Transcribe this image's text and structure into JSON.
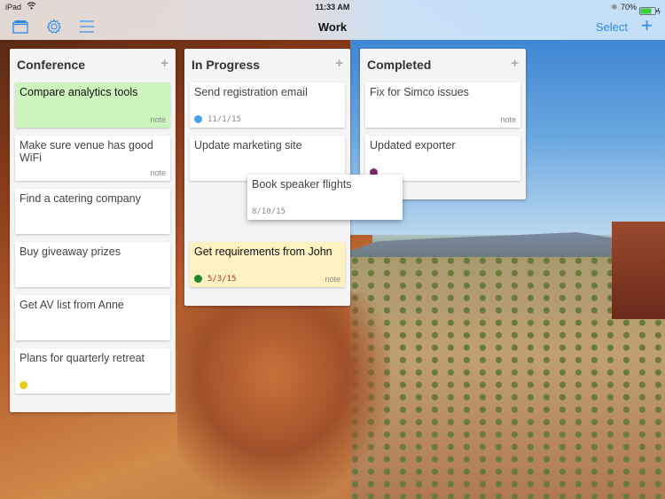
{
  "status_bar": {
    "device": "iPad",
    "time": "11:33 AM",
    "battery": "70%"
  },
  "nav": {
    "title": "Work",
    "select_label": "Select",
    "add_label": "+",
    "icons": [
      "boards-icon",
      "gear-icon",
      "menu-icon"
    ]
  },
  "colors": {
    "accent": "#2d8ae6",
    "green_card": "#ccf5be",
    "yellow_card": "#fdf2c0"
  },
  "columns": [
    {
      "title": "Conference",
      "add_label": "+",
      "cards": [
        {
          "title": "Compare analytics tools",
          "note": "note",
          "color": "green"
        },
        {
          "title": "Make sure venue has good WiFi",
          "note": "note"
        },
        {
          "title": "Find a catering company"
        },
        {
          "title": "Buy giveaway prizes"
        },
        {
          "title": "Get AV list from Anne"
        },
        {
          "title": "Plans for quarterly retreat",
          "label_color": "#e8cc1e"
        }
      ]
    },
    {
      "title": "In Progress",
      "add_label": "+",
      "cards": [
        {
          "title": "Send registration email",
          "date": "11/1/15",
          "label_color": "#4a9ff0"
        },
        {
          "title": "Update marketing site"
        },
        {
          "title": "Get requirements from John",
          "date": "5/3/15",
          "note": "note",
          "label_color": "#1a8a2a",
          "color": "yellow"
        }
      ]
    },
    {
      "title": "Completed",
      "add_label": "+",
      "cards": [
        {
          "title": "Fix for Simco issues",
          "note": "note"
        },
        {
          "title": "Updated exporter",
          "label_color": "#7a2a6a"
        }
      ]
    }
  ],
  "dragging_card": {
    "title": "Book speaker flights",
    "date": "8/10/15"
  }
}
